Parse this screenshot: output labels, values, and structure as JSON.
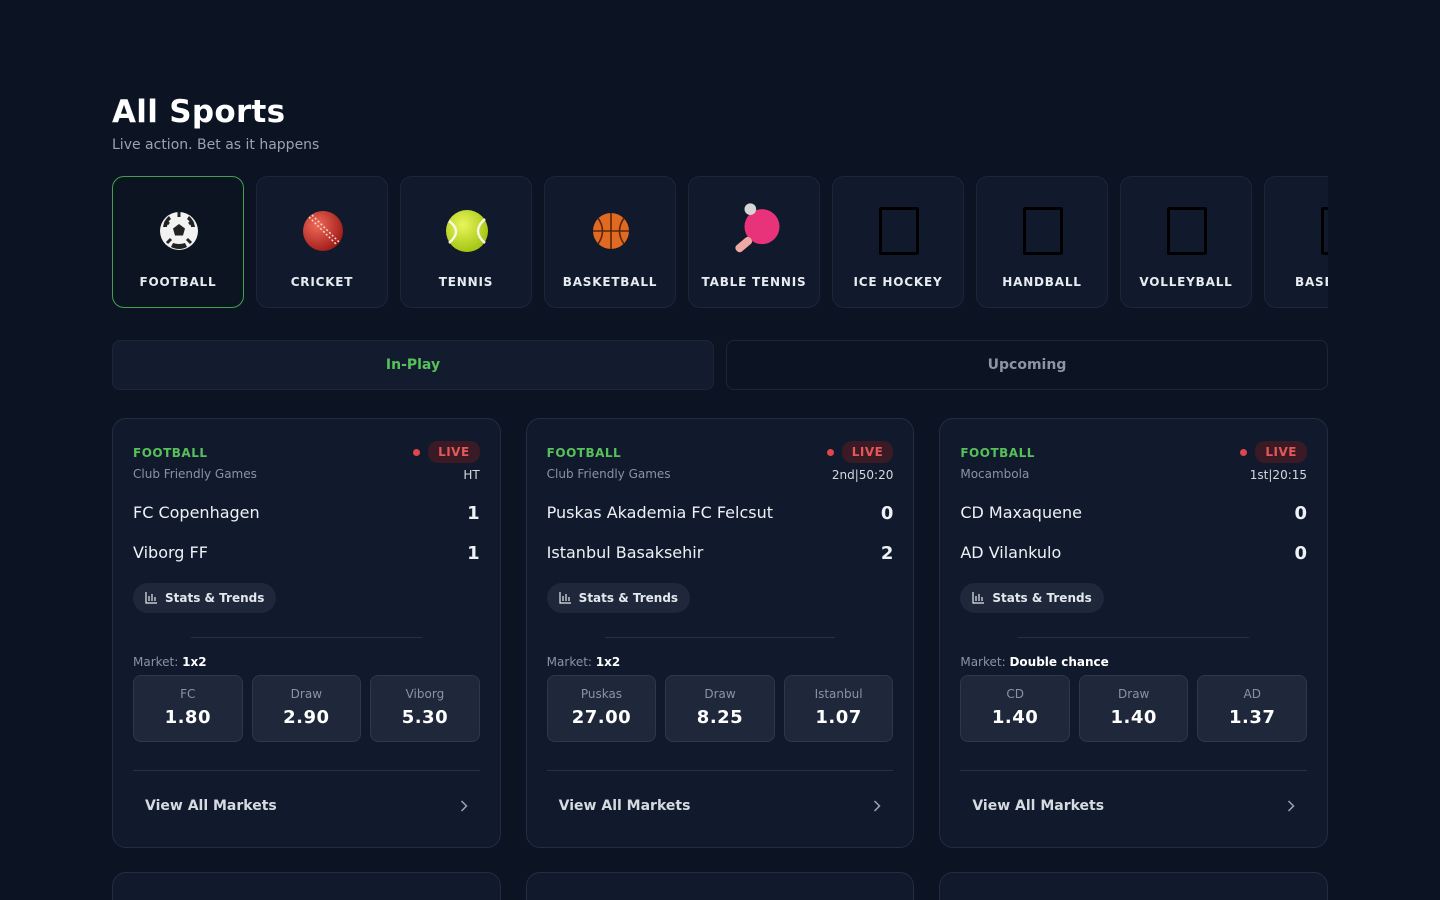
{
  "header": {
    "title": "All Sports",
    "subtitle": "Live action. Bet as it happens"
  },
  "sports": [
    {
      "label": "FOOTBALL",
      "icon": "football-icon",
      "active": true
    },
    {
      "label": "CRICKET",
      "icon": "cricket-ball-icon"
    },
    {
      "label": "TENNIS",
      "icon": "tennis-ball-icon"
    },
    {
      "label": "BASKETBALL",
      "icon": "basketball-icon"
    },
    {
      "label": "TABLE TENNIS",
      "icon": "table-tennis-icon"
    },
    {
      "label": "ICE HOCKEY",
      "icon": "missing-glyph-icon"
    },
    {
      "label": "HANDBALL",
      "icon": "missing-glyph-icon"
    },
    {
      "label": "VOLLEYBALL",
      "icon": "missing-glyph-icon"
    },
    {
      "label": "BASE",
      "icon": "missing-glyph-icon"
    }
  ],
  "tabs": {
    "in_play": "In-Play",
    "upcoming": "Upcoming"
  },
  "matches": [
    {
      "sport": "FOOTBALL",
      "league": "Club Friendly Games",
      "live_label": "LIVE",
      "time": "HT",
      "team1": "FC Copenhagen",
      "score1": "1",
      "team2": "Viborg FF",
      "score2": "1",
      "stats_label": "Stats & Trends",
      "market_prefix": "Market:",
      "market": "1x2",
      "odds": [
        {
          "label": "FC",
          "value": "1.80"
        },
        {
          "label": "Draw",
          "value": "2.90"
        },
        {
          "label": "Viborg",
          "value": "5.30"
        }
      ],
      "view_all": "View All Markets"
    },
    {
      "sport": "FOOTBALL",
      "league": "Club Friendly Games",
      "live_label": "LIVE",
      "time": "2nd|50:20",
      "team1": "Puskas Akademia FC Felcsut",
      "score1": "0",
      "team2": "Istanbul Basaksehir",
      "score2": "2",
      "stats_label": "Stats & Trends",
      "market_prefix": "Market:",
      "market": "1x2",
      "odds": [
        {
          "label": "Puskas",
          "value": "27.00"
        },
        {
          "label": "Draw",
          "value": "8.25"
        },
        {
          "label": "Istanbul",
          "value": "1.07"
        }
      ],
      "view_all": "View All Markets"
    },
    {
      "sport": "FOOTBALL",
      "league": "Mocambola",
      "live_label": "LIVE",
      "time": "1st|20:15",
      "team1": "CD Maxaquene",
      "score1": "0",
      "team2": "AD Vilankulo",
      "score2": "0",
      "stats_label": "Stats & Trends",
      "market_prefix": "Market:",
      "market": "Double chance",
      "odds": [
        {
          "label": "CD",
          "value": "1.40"
        },
        {
          "label": "Draw",
          "value": "1.40"
        },
        {
          "label": "AD",
          "value": "1.37"
        }
      ],
      "view_all": "View All Markets"
    }
  ],
  "colors": {
    "background": "#0c1322",
    "card": "#111a2c",
    "accent_green": "#58c05a",
    "live_red": "#e65757"
  }
}
